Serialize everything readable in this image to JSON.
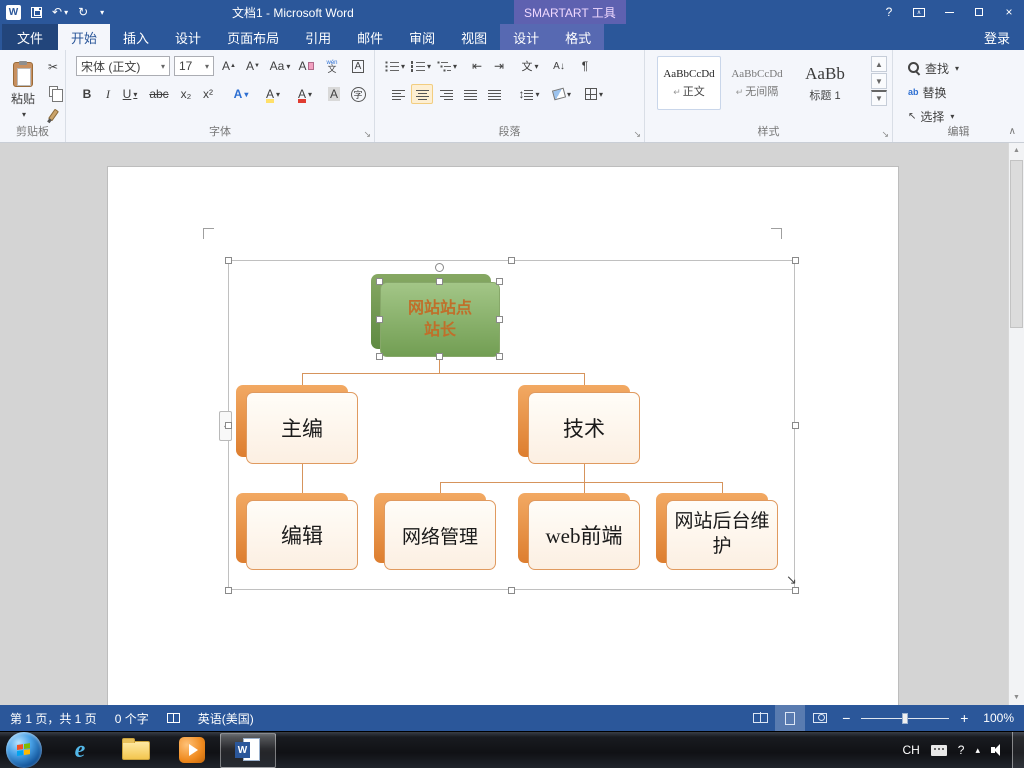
{
  "titlebar": {
    "app_title": "文档1 - Microsoft Word",
    "context_label": "SMARTART 工具",
    "signin": "登录"
  },
  "icons": {
    "word_logo": "W",
    "ie": "e"
  },
  "tabs": {
    "file": "文件",
    "main": [
      "开始",
      "插入",
      "设计",
      "页面布局",
      "引用",
      "邮件",
      "审阅",
      "视图"
    ],
    "contextual": [
      "设计",
      "格式"
    ]
  },
  "ribbon": {
    "clipboard": {
      "group": "剪贴板",
      "paste": "粘贴"
    },
    "font": {
      "group": "字体",
      "name": "宋体 (正文)",
      "size": "17",
      "grow": "A",
      "shrink": "A",
      "case": "Aa",
      "clear": "A",
      "ruby_top": "wén",
      "ruby_base": "文",
      "char_border": "A",
      "bold": "B",
      "italic": "I",
      "underline": "U",
      "strike": "abc",
      "subscript": "x₂",
      "superscript": "x²",
      "effects": "A",
      "highlight": "A",
      "color": "A",
      "char_shading": "A",
      "enclose": "字"
    },
    "paragraph": {
      "group": "段落",
      "asian": "文",
      "sort": "A↓",
      "marks": "¶",
      "spacing": "↕"
    },
    "styles": {
      "group": "样式",
      "items": [
        {
          "marker": "↵",
          "preview": "AaBbCcDd",
          "name": "正文"
        },
        {
          "marker": "↵",
          "preview": "AaBbCcDd",
          "name": "无间隔"
        },
        {
          "marker": "",
          "preview": "AaBb",
          "name": "标题 1"
        }
      ]
    },
    "editing": {
      "group": "编辑",
      "find": "查找",
      "replace": "替换",
      "select": "选择"
    }
  },
  "document": {
    "smartart": {
      "root": "网站站点站长",
      "level2": [
        "主编",
        "技术"
      ],
      "level3": [
        "编辑",
        "网络管理",
        "web前端",
        "网站后台维护"
      ]
    }
  },
  "statusbar": {
    "page_info": "第 1 页，共 1 页",
    "word_count": "0 个字",
    "language": "英语(美国)",
    "zoom": "100%"
  },
  "taskbar": {
    "ime": "CH"
  }
}
